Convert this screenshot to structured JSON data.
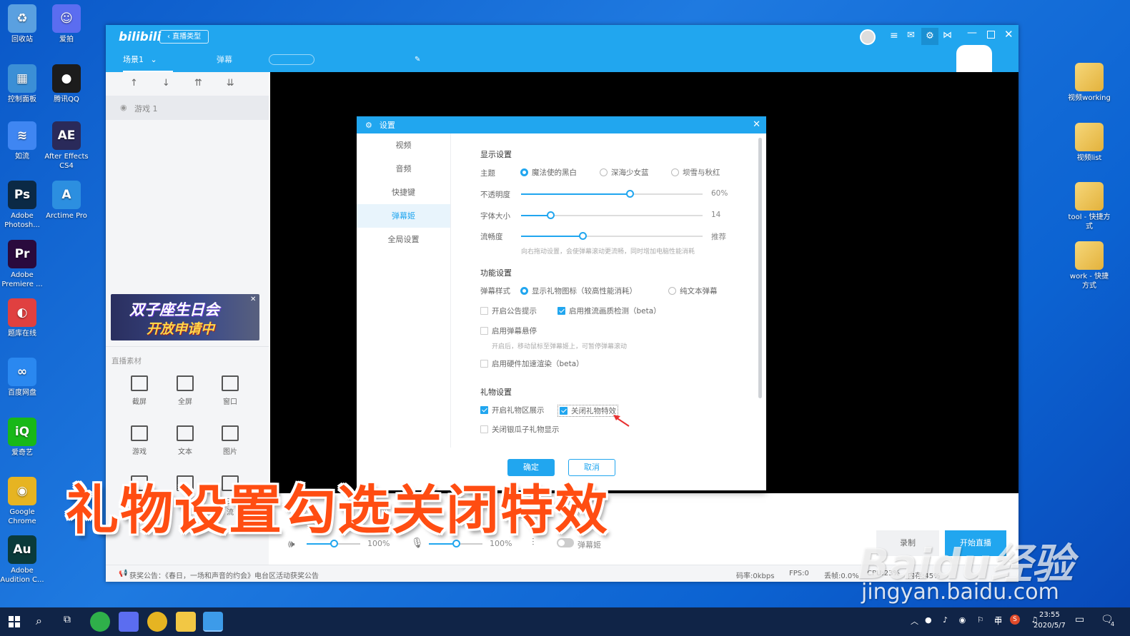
{
  "desktop": {
    "left_icons": [
      {
        "label": "回收站",
        "icon": "recycle-bin-icon",
        "color": "#5aa0e0",
        "glyph": "♻"
      },
      {
        "label": "爱拍",
        "icon": "aipai-icon",
        "color": "#5b6df0",
        "glyph": "☺"
      },
      {
        "label": "控制面板",
        "icon": "control-panel-icon",
        "color": "#3b8fd6",
        "glyph": "▦"
      },
      {
        "label": "腾讯QQ",
        "icon": "qq-icon",
        "color": "#1c1c1c",
        "glyph": "●"
      },
      {
        "label": "如流",
        "icon": "ruliu-icon",
        "color": "#3f86f2",
        "glyph": "≋"
      },
      {
        "label": "After Effects CS4",
        "icon": "after-effects-icon",
        "color": "#2a2a5a",
        "glyph": "AE"
      },
      {
        "label": "Adobe Photosh...",
        "icon": "photoshop-icon",
        "color": "#0b2945",
        "glyph": "Ps"
      },
      {
        "label": "Arctime Pro",
        "icon": "arctime-icon",
        "color": "#2c8fe0",
        "glyph": "A"
      },
      {
        "label": "Adobe Premiere ...",
        "icon": "premiere-icon",
        "color": "#2a0a3d",
        "glyph": "Pr"
      },
      {
        "label": "题库在线",
        "icon": "tiku-icon",
        "color": "#e04040",
        "glyph": "◐"
      },
      {
        "label": "百度网盘",
        "icon": "baidu-netdisk-icon",
        "color": "#2a88f0",
        "glyph": "∞"
      },
      {
        "label": "爱奇艺",
        "icon": "iqiyi-icon",
        "color": "#18b818",
        "glyph": "iQ"
      },
      {
        "label": "Google Chrome",
        "icon": "chrome-icon",
        "color": "#e6b422",
        "glyph": "◉"
      },
      {
        "label": "Adobe Audition C...",
        "icon": "audition-icon",
        "color": "#0a3b3b",
        "glyph": "Au"
      }
    ],
    "right_icons": [
      {
        "label": "视频working",
        "icon": "folder-icon"
      },
      {
        "label": "视频list",
        "icon": "folder-icon"
      },
      {
        "label": "tool - 快捷方式",
        "icon": "folder-shortcut-icon"
      },
      {
        "label": "work - 快捷方式",
        "icon": "folder-shortcut-icon"
      }
    ]
  },
  "app": {
    "logo": "bilibili",
    "live_type_btn": "‹ 直播类型",
    "scene_tab": "场景1",
    "danmaku_tab": "弹幕",
    "source_item": "游戏 1",
    "banner_line1": "双子座生日会",
    "banner_line2": "开放申请中",
    "materials_title": "直播素材",
    "tools": [
      {
        "label": "截屏",
        "icon": "crop-icon"
      },
      {
        "label": "全屏",
        "icon": "monitor-icon"
      },
      {
        "label": "窗口",
        "icon": "window-icon"
      },
      {
        "label": "游戏",
        "icon": "gamepad-icon"
      },
      {
        "label": "文本",
        "icon": "text-icon"
      },
      {
        "label": "图片",
        "icon": "image-icon"
      },
      {
        "label": "浏览器",
        "icon": "planet-icon"
      },
      {
        "label": "音频",
        "icon": "music-icon"
      },
      {
        "label": "第三方推流",
        "icon": "stream-icon"
      }
    ],
    "speaker_volume": "100%",
    "speaker_level": 0.5,
    "mic_volume": "100%",
    "mic_level": 0.5,
    "danmaku_toggle": "弹幕姬",
    "record_btn": "录制",
    "start_live_btn": "开始直播",
    "status_notice": "获奖公告：《春日，一场和声音的约会》电台区活动获奖公告",
    "status_bitrate": "码率:0kbps",
    "status_fps": "FPS:0",
    "status_drop": "丢帧:0.0%",
    "status_cpu": "CPU:23%",
    "status_mem": "内存:45%"
  },
  "dialog": {
    "title": "设置",
    "nav": [
      "视频",
      "音频",
      "快捷键",
      "弹幕姬",
      "全局设置"
    ],
    "active_nav": 3,
    "display_section": "显示设置",
    "theme_label": "主题",
    "themes": [
      "魔法使的黑白",
      "深海少女蓝",
      "坝雪与秋红"
    ],
    "opacity_label": "不透明度",
    "opacity_value": "60%",
    "opacity_level": 0.6,
    "fontsize_label": "字体大小",
    "fontsize_value": "14",
    "fontsize_level": 0.16,
    "smooth_label": "流畅度",
    "smooth_value": "推荐",
    "smooth_level": 0.34,
    "smooth_hint": "向右拖动设置，会使弹幕滚动更流畅，同时增加电脑性能消耗",
    "function_section": "功能设置",
    "style_label": "弹幕样式",
    "style_opt1": "显示礼物图标（较高性能消耗）",
    "style_opt2": "纯文本弹幕",
    "chk_notice": "开启公告提示",
    "chk_quality": "启用推流画质检测（beta）",
    "chk_pause": "启用弹幕悬停",
    "pause_hint": "开启后，移动鼠标至弹幕姬上，可暂停弹幕滚动",
    "chk_hw": "启用硬件加速渲染（beta）",
    "gift_section": "礼物设置",
    "chk_gift_area": "开启礼物区展示",
    "chk_gift_effect": "关闭礼物特效",
    "chk_melon": "关闭银瓜子礼物显示",
    "ok_btn": "确定",
    "cancel_btn": "取消"
  },
  "caption": "礼物设置勾选关闭特效",
  "watermark": {
    "line1": "Baidu经验",
    "line2": "jingyan.baidu.com"
  },
  "taskbar": {
    "time": "23:55",
    "date": "2020/5/7",
    "ime": "中",
    "notif_count": "4"
  },
  "colors": {
    "accent": "#21a6ef",
    "caption": "#ff4d12"
  }
}
